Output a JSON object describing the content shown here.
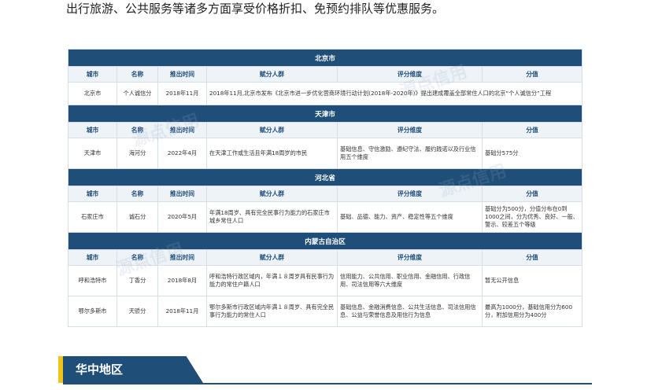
{
  "intro_text": "出行旅游、公共服务等诸多方面享受价格折扣、免预约排队等优惠服务。",
  "watermark_text": "源点信用",
  "columns": [
    "城市",
    "名称",
    "推出时间",
    "赋分人群",
    "评分维度",
    "分值"
  ],
  "regions": [
    {
      "name": "北京市",
      "rows": [
        {
          "city": "北京市",
          "score_name": "个人诚信分",
          "launch": "2018年11月",
          "merged": "2018年11月,北京市发布《北京市进一步优化营商环境行动计划(2018年-2020年)》提出建成覆盖全部常住人口的北京“个人诚信分”工程"
        }
      ]
    },
    {
      "name": "天津市",
      "rows": [
        {
          "city": "天津市",
          "score_name": "海河分",
          "launch": "2022年4月",
          "group": "在天津工作或生活且年满18周岁的市民",
          "dims": "基础信息、守信激励、遵纪守法、履约践诺以及行业信用五个维度",
          "value": "基础分575分"
        }
      ]
    },
    {
      "name": "河北省",
      "rows": [
        {
          "city": "石家庄市",
          "score_name": "诚石分",
          "launch": "2020年5月",
          "group": "年满18周岁、具有完全民事行为能力的石家庄市城乡常住人口",
          "dims": "基础、品德、能力、资产、稳定性等五个维度",
          "value": "基础分为500分，分值分布在0到1000之间，分为优秀、良好、一般、警示、较差五个等级"
        }
      ]
    },
    {
      "name": "内蒙古自治区",
      "rows": [
        {
          "city": "呼和浩特市",
          "score_name": "丁香分",
          "launch": "2018年8月",
          "group": "呼和浩特行政区域内，年满１８周岁具有民事行为能力的常住户籍人口",
          "dims": "信用能力、公共信用、职业信用、金融信用、行政信用、司法信用等六大维度",
          "value": "暂无公开信息"
        },
        {
          "city": "鄂尔多斯市",
          "score_name": "天骄分",
          "launch": "2018年11月",
          "group": "鄂尔多斯市行政区域内年满１８周岁、具有完全民事行为能力的常住人口",
          "dims": "基础信息、金融消费信息、公共生活信息、司法信用信息、公益与荣誉信息及用信行为信息",
          "value": "最高为1000分，基础信用分为600分，附加信用分为400分"
        }
      ]
    }
  ],
  "section": {
    "title": "华中地区"
  },
  "colors": {
    "navy": "#1f4e79",
    "accent": "#f0c419",
    "header_bg": "#eef3f8"
  }
}
